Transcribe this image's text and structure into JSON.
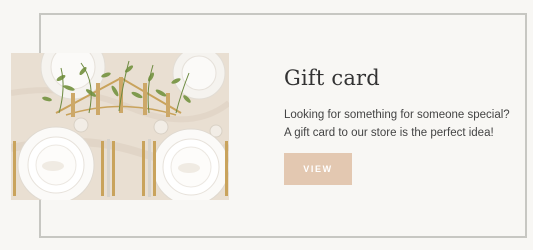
{
  "promo": {
    "title": "Gift card",
    "description_lines": [
      "Looking for something for someone special?",
      "A gift card to our store is the perfect idea!"
    ],
    "button_label": "VIEW",
    "accent_color": "#e3c8b1",
    "frame_color": "#c7c7c2",
    "image_subject": "table-setting-photo"
  }
}
